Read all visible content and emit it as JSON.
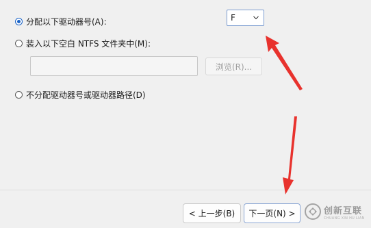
{
  "options": {
    "assign_letter_label": "分配以下驱动器号(A):",
    "mount_folder_label": "装入以下空白 NTFS 文件夹中(M):",
    "no_letter_label": "不分配驱动器号或驱动器路径(D)"
  },
  "drive_letter": {
    "selected": "F"
  },
  "folder_path": {
    "value": ""
  },
  "browse_label": "浏览(R)...",
  "footer": {
    "back_label": "< 上一步(B)",
    "next_label": "下一页(N) >"
  },
  "watermark": {
    "name": "创新互联",
    "sub": "CHUANG XIN HU LIAN"
  },
  "colors": {
    "accent": "#1a63c8",
    "annotation_arrow": "#e8322d"
  }
}
